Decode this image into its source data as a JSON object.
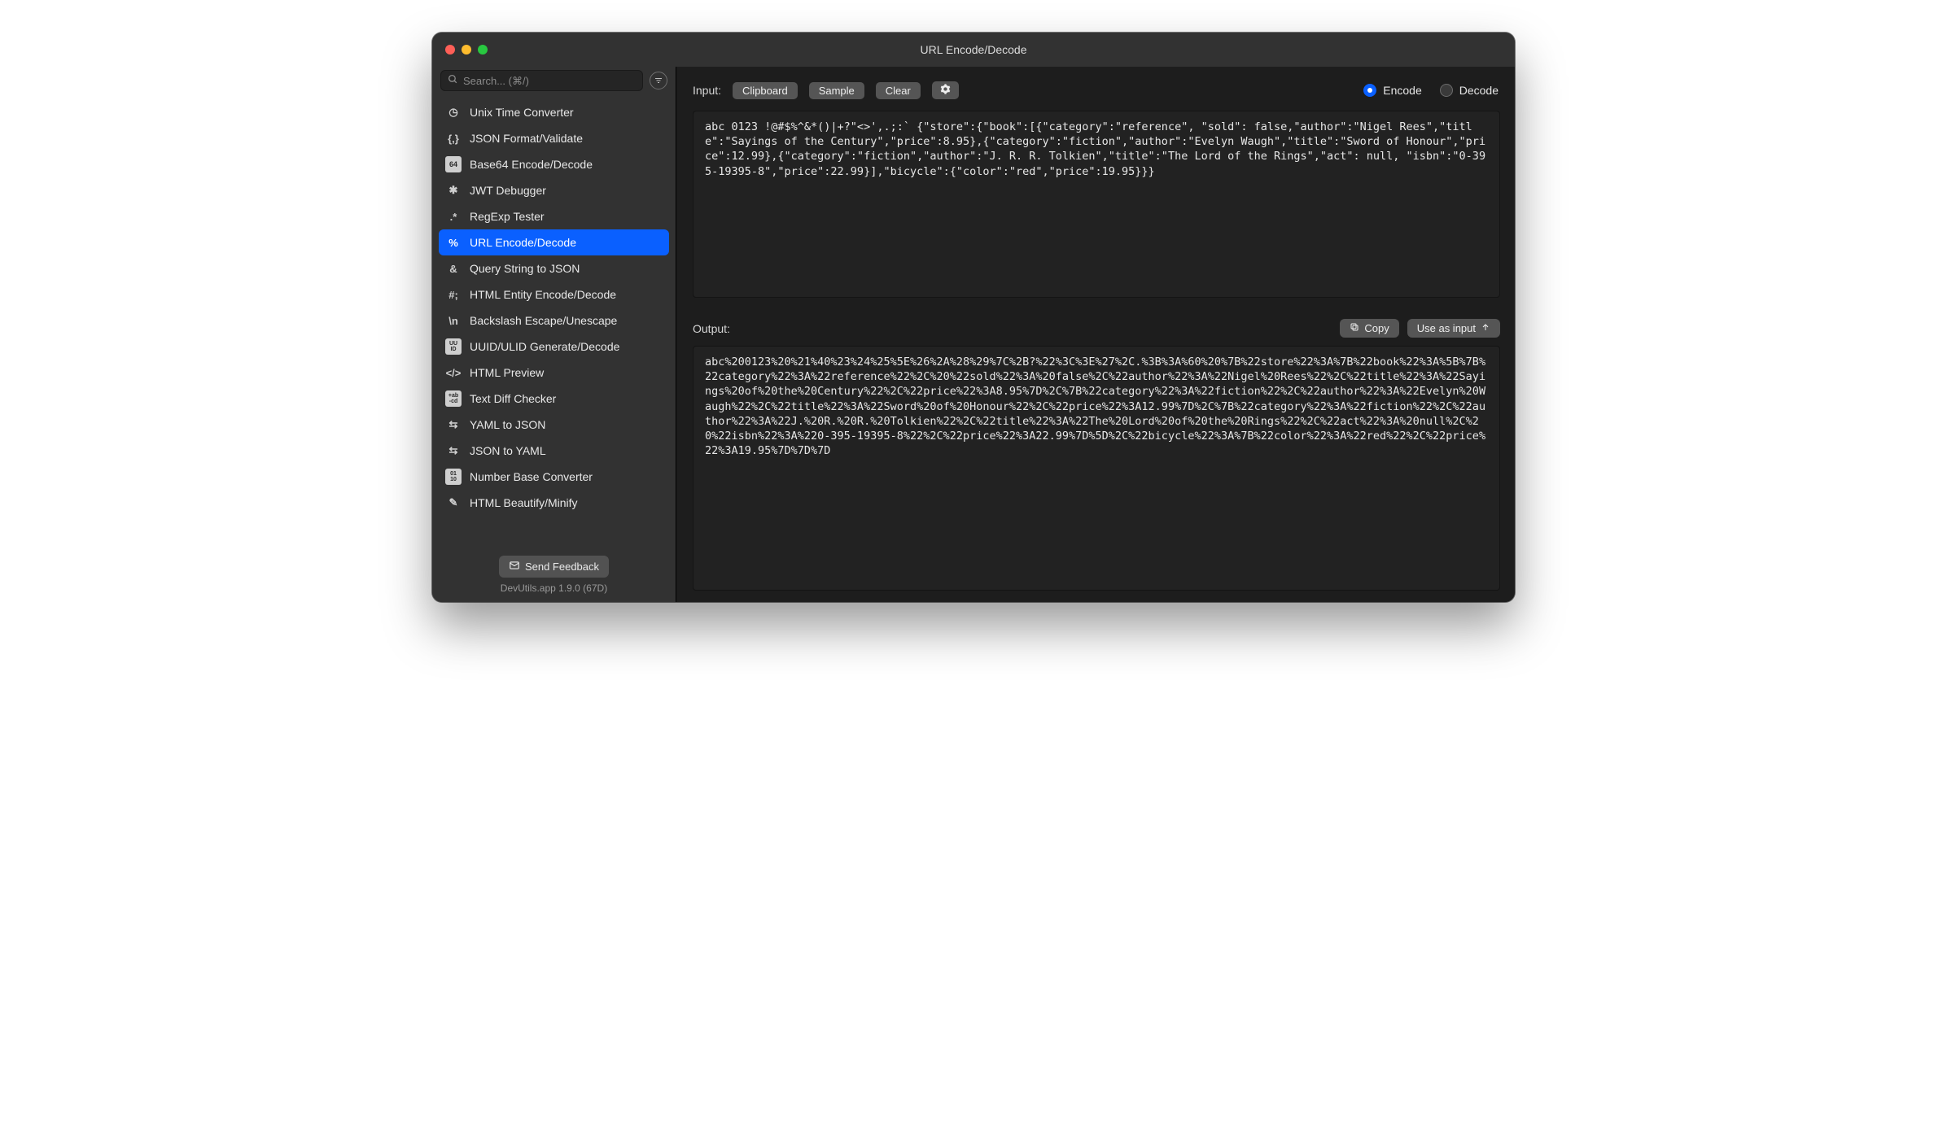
{
  "window": {
    "title": "URL Encode/Decode"
  },
  "search": {
    "placeholder": "Search... (⌘/)"
  },
  "sidebar": {
    "items": [
      {
        "id": "unix-time",
        "label": "Unix Time Converter",
        "icon": "clock"
      },
      {
        "id": "json-format",
        "label": "JSON Format/Validate",
        "icon": "braces"
      },
      {
        "id": "base64",
        "label": "Base64 Encode/Decode",
        "icon": "b64"
      },
      {
        "id": "jwt",
        "label": "JWT Debugger",
        "icon": "jwt"
      },
      {
        "id": "regexp",
        "label": "RegExp Tester",
        "icon": "regex"
      },
      {
        "id": "url-encode",
        "label": "URL Encode/Decode",
        "icon": "percent",
        "selected": true
      },
      {
        "id": "query-json",
        "label": "Query String to JSON",
        "icon": "amp"
      },
      {
        "id": "html-entity",
        "label": "HTML Entity Encode/Decode",
        "icon": "hash"
      },
      {
        "id": "backslash",
        "label": "Backslash Escape/Unescape",
        "icon": "backslash"
      },
      {
        "id": "uuid",
        "label": "UUID/ULID Generate/Decode",
        "icon": "uuid"
      },
      {
        "id": "html-preview",
        "label": "HTML Preview",
        "icon": "tag"
      },
      {
        "id": "text-diff",
        "label": "Text Diff Checker",
        "icon": "diff"
      },
      {
        "id": "yaml2json",
        "label": "YAML to JSON",
        "icon": "swap"
      },
      {
        "id": "json2yaml",
        "label": "JSON to YAML",
        "icon": "swap"
      },
      {
        "id": "number-base",
        "label": "Number Base Converter",
        "icon": "binary"
      },
      {
        "id": "html-beautify",
        "label": "HTML Beautify/Minify",
        "icon": "wand"
      }
    ],
    "feedback_label": "Send Feedback",
    "version_label": "DevUtils.app 1.9.0 (67D)"
  },
  "toolbar": {
    "input_label": "Input:",
    "clipboard_label": "Clipboard",
    "sample_label": "Sample",
    "clear_label": "Clear",
    "mode": {
      "encode_label": "Encode",
      "decode_label": "Decode",
      "selected": "encode"
    }
  },
  "input": {
    "text": "abc 0123 !@#$%^&*()|+?\"<>',.;:` {\"store\":{\"book\":[{\"category\":\"reference\", \"sold\": false,\"author\":\"Nigel Rees\",\"title\":\"Sayings of the Century\",\"price\":8.95},{\"category\":\"fiction\",\"author\":\"Evelyn Waugh\",\"title\":\"Sword of Honour\",\"price\":12.99},{\"category\":\"fiction\",\"author\":\"J. R. R. Tolkien\",\"title\":\"The Lord of the Rings\",\"act\": null, \"isbn\":\"0-395-19395-8\",\"price\":22.99}],\"bicycle\":{\"color\":\"red\",\"price\":19.95}}}"
  },
  "output": {
    "label": "Output:",
    "copy_label": "Copy",
    "use_as_input_label": "Use as input",
    "text": "abc%200123%20%21%40%23%24%25%5E%26%2A%28%29%7C%2B?%22%3C%3E%27%2C.%3B%3A%60%20%7B%22store%22%3A%7B%22book%22%3A%5B%7B%22category%22%3A%22reference%22%2C%20%22sold%22%3A%20false%2C%22author%22%3A%22Nigel%20Rees%22%2C%22title%22%3A%22Sayings%20of%20the%20Century%22%2C%22price%22%3A8.95%7D%2C%7B%22category%22%3A%22fiction%22%2C%22author%22%3A%22Evelyn%20Waugh%22%2C%22title%22%3A%22Sword%20of%20Honour%22%2C%22price%22%3A12.99%7D%2C%7B%22category%22%3A%22fiction%22%2C%22author%22%3A%22J.%20R.%20R.%20Tolkien%22%2C%22title%22%3A%22The%20Lord%20of%20the%20Rings%22%2C%22act%22%3A%20null%2C%20%22isbn%22%3A%220-395-19395-8%22%2C%22price%22%3A22.99%7D%5D%2C%22bicycle%22%3A%7B%22color%22%3A%22red%22%2C%22price%22%3A19.95%7D%7D%7D"
  },
  "icons": {
    "clock": "◷",
    "braces": "{,}",
    "b64": "64",
    "jwt": "✱",
    "regex": ".*",
    "percent": "%",
    "amp": "&",
    "hash": "#;",
    "backslash": "\\n",
    "uuid": "UU\nID",
    "tag": "</>",
    "diff": "+ab\n-cd",
    "swap": "⇆",
    "binary": "01\n10",
    "wand": "✎"
  }
}
